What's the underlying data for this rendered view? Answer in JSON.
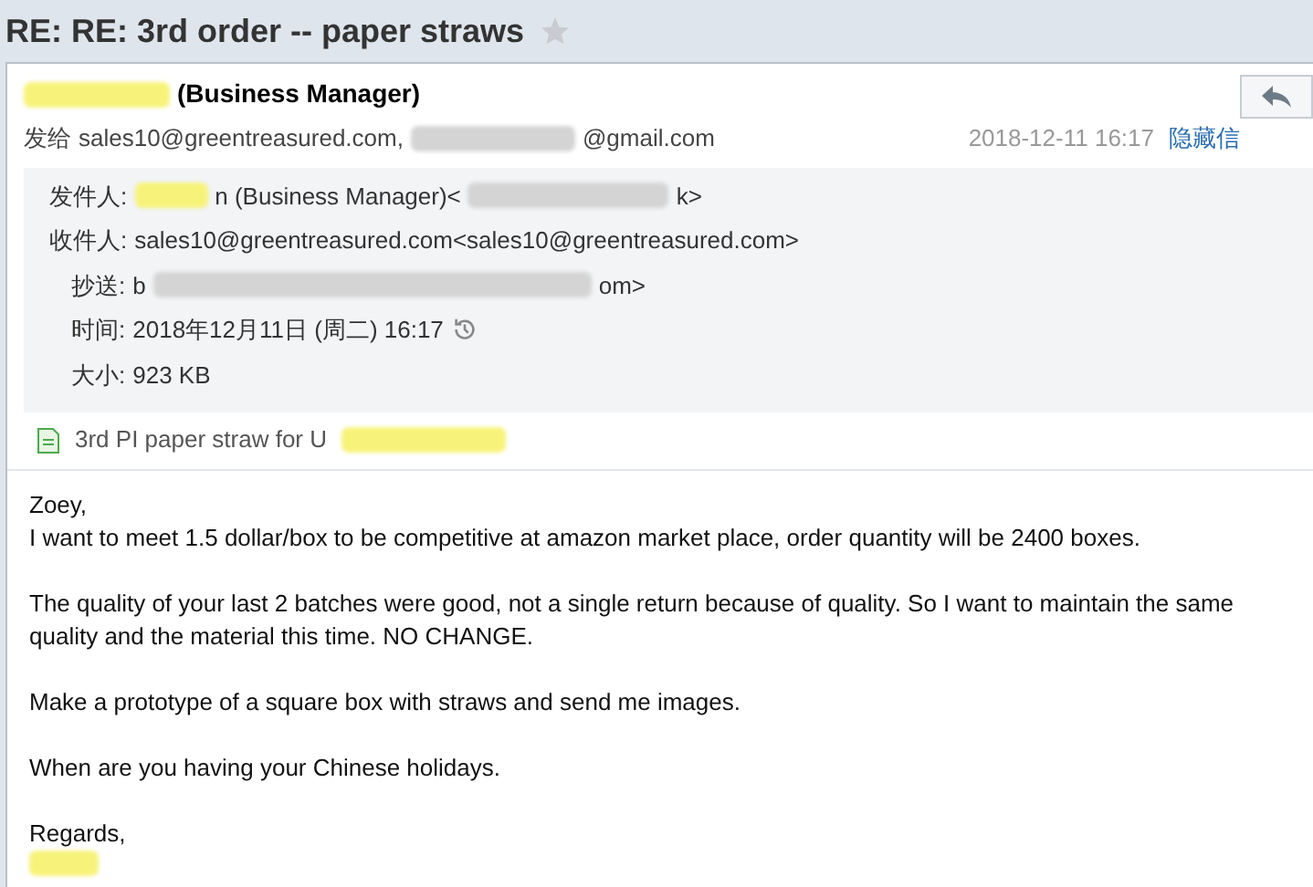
{
  "subject": "RE: RE: 3rd order -- paper straws",
  "starred": false,
  "sender": {
    "name": "(Business Manager)"
  },
  "recipients_line": {
    "label": "发给",
    "value": "sales10@greentreasured.com,",
    "rest": "@gmail.com"
  },
  "date": "2018-12-11 16:17",
  "hide_link": "隐藏信",
  "details": [
    {
      "kind": "from",
      "label": "发件人:",
      "value": "n (Business Manager)<",
      "tail": "k>"
    },
    {
      "kind": "to",
      "label": "收件人:",
      "value": "sales10@greentreasured.com<sales10@greentreasured.com>"
    },
    {
      "kind": "cc",
      "label": "抄送:",
      "value": "b",
      "tail": "om>"
    },
    {
      "kind": "time",
      "label": "时间:",
      "value": "2018年12月11日 (周二) 16:17"
    },
    {
      "kind": "size",
      "label": "大小:",
      "value": "923 KB"
    }
  ],
  "attachment": {
    "name": "3rd PI paper straw for U"
  },
  "body": [
    [
      "Zoey,",
      "I want to meet 1.5 dollar/box to be competitive at amazon market place, order quantity will be 2400 boxes."
    ],
    [
      "The quality of your last 2 batches were good, not a single return because of quality. So I want to maintain the same",
      "quality and the material this time. NO CHANGE."
    ],
    [
      "Make a prototype of a square box with straws and send me images."
    ],
    [
      "When are you having your Chinese holidays."
    ],
    [
      "Regards,"
    ]
  ]
}
